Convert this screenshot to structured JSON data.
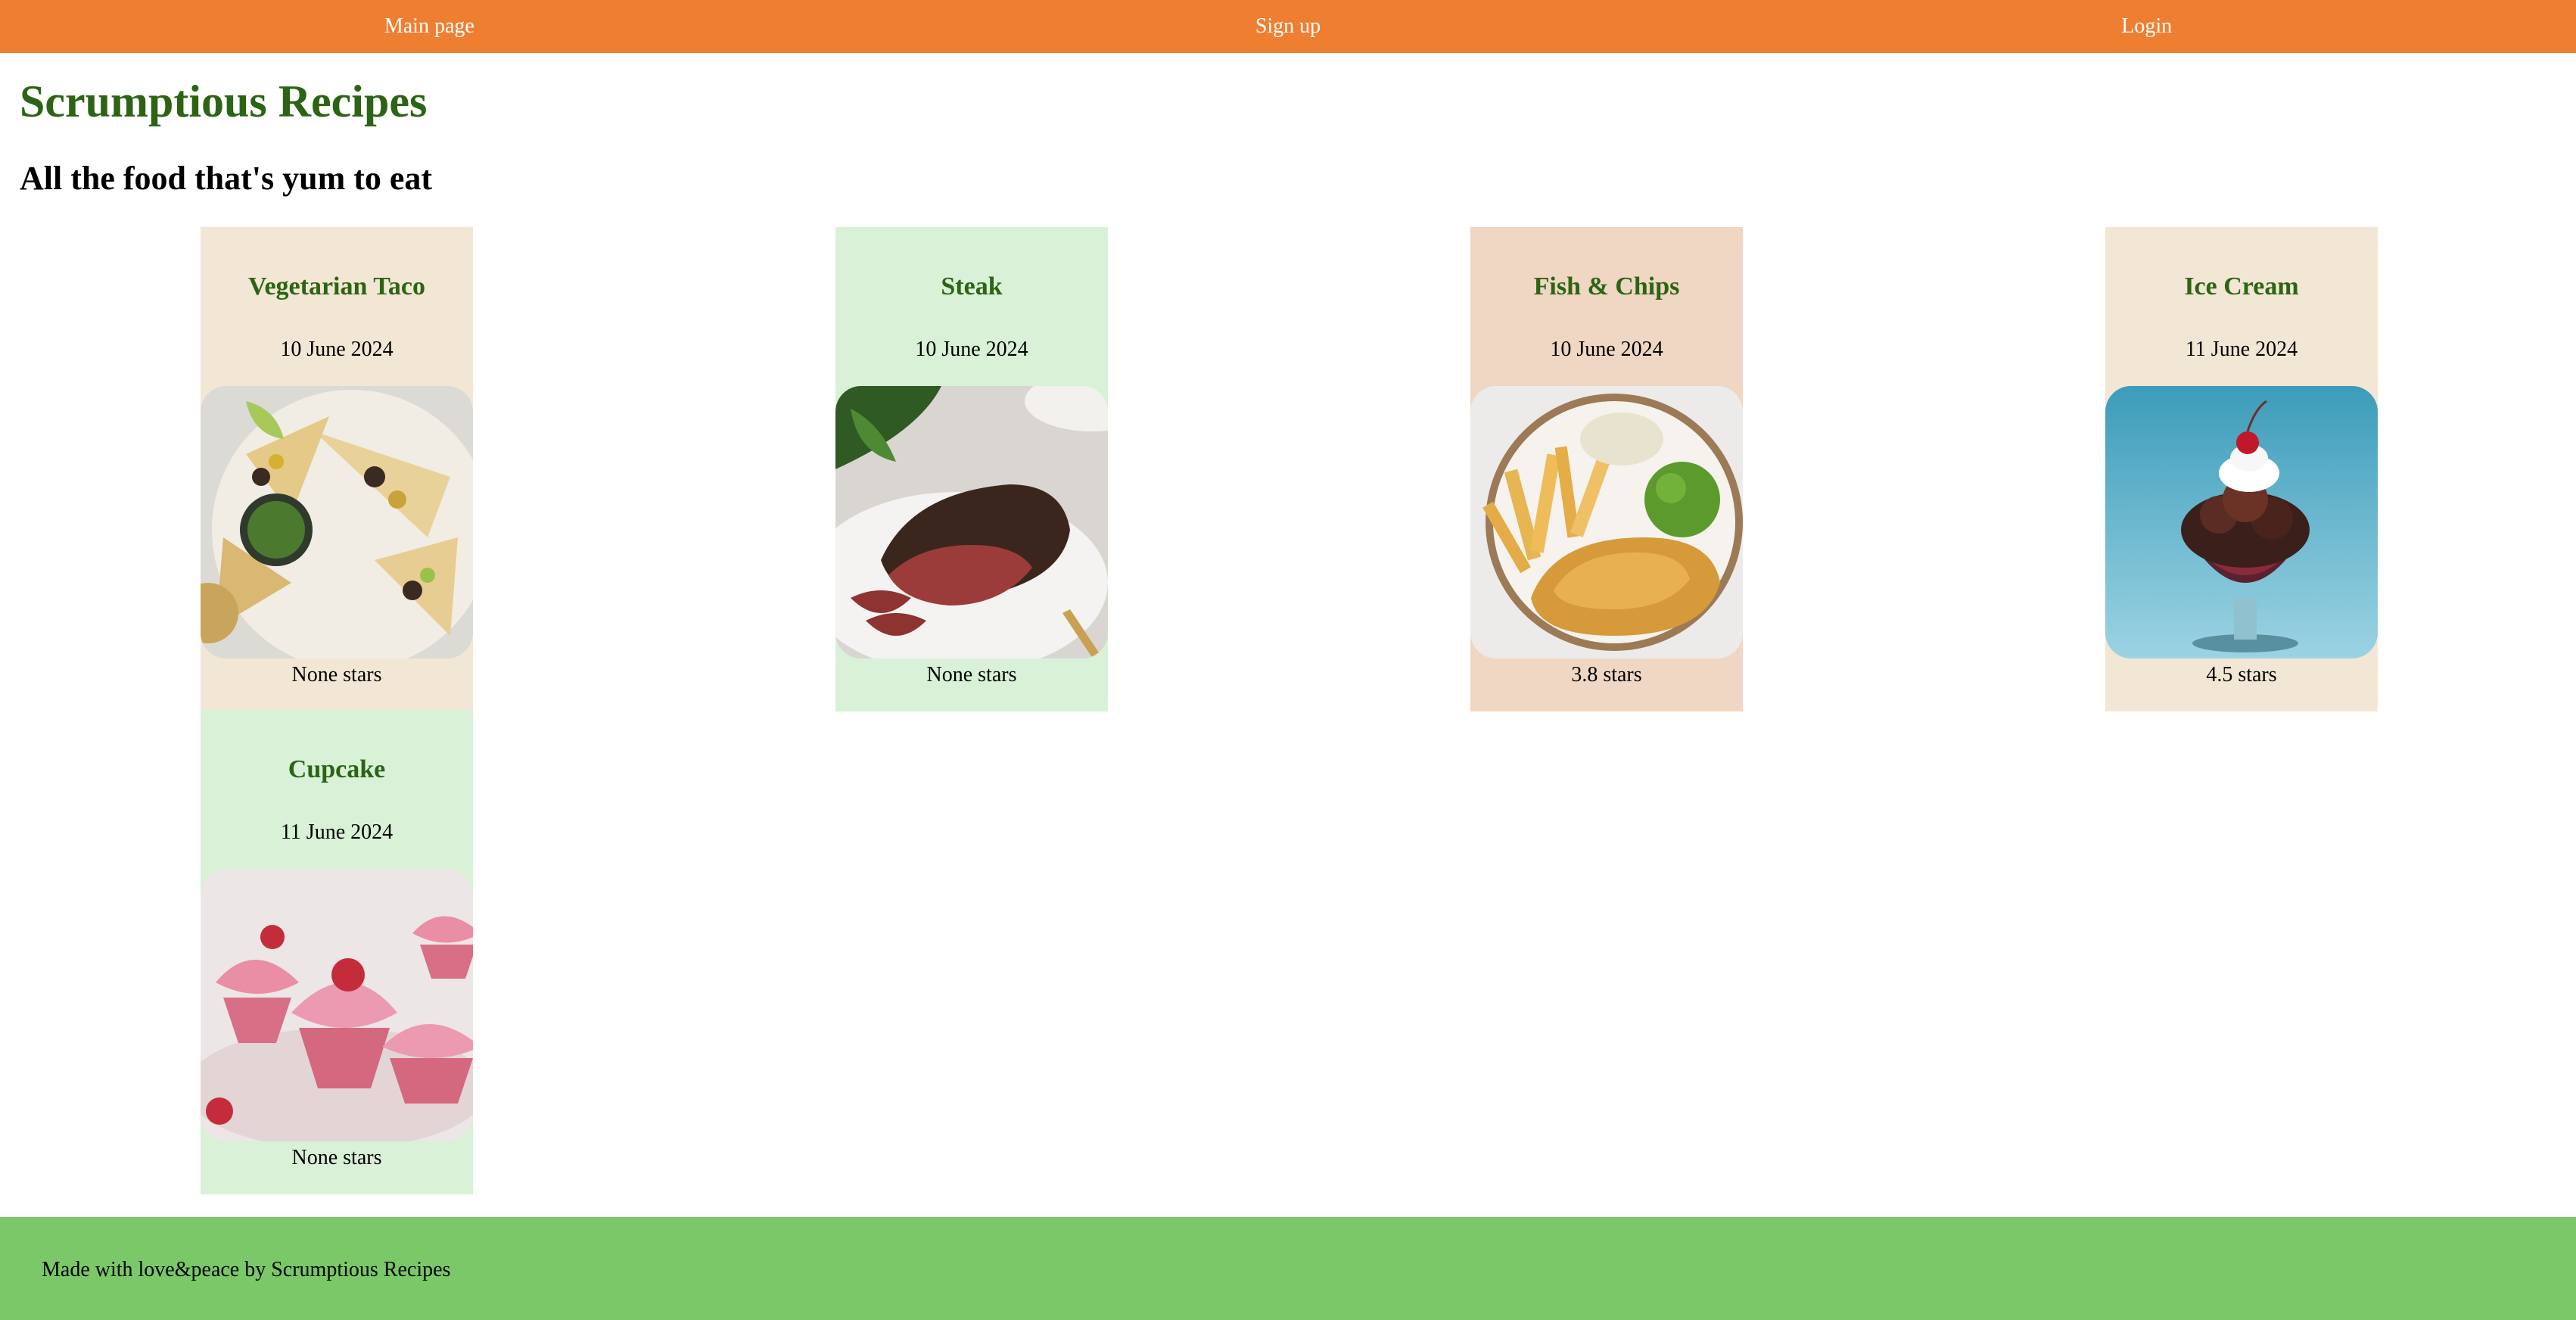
{
  "nav": {
    "items": [
      {
        "label": "Main page"
      },
      {
        "label": "Sign up"
      },
      {
        "label": "Login"
      }
    ]
  },
  "header": {
    "title": "Scrumptious Recipes",
    "subtitle": "All the food that's yum to eat"
  },
  "recipes": [
    {
      "name": "Vegetarian Taco",
      "date": "10 June 2024",
      "rating": "None stars",
      "bg": "#f2e7d5",
      "image": "taco-photo"
    },
    {
      "name": "Steak",
      "date": "10 June 2024",
      "rating": "None stars",
      "bg": "#d8f1d7",
      "image": "steak-photo"
    },
    {
      "name": "Fish & Chips",
      "date": "10 June 2024",
      "rating": "3.8 stars",
      "bg": "#efd7c3",
      "image": "fish-and-chips-photo"
    },
    {
      "name": "Ice Cream",
      "date": "11 June 2024",
      "rating": "4.5 stars",
      "bg": "#f2e7d5",
      "image": "ice-cream-photo"
    },
    {
      "name": "Cupcake",
      "date": "11 June 2024",
      "rating": "None stars",
      "bg": "#d8f1d7",
      "image": "cupcake-photo"
    }
  ],
  "footer": {
    "text": "Made with love&peace by Scrumptious Recipes"
  },
  "colors": {
    "nav_bg": "#ee7f30",
    "title": "#2d6414",
    "footer_bg": "#7ac867"
  }
}
